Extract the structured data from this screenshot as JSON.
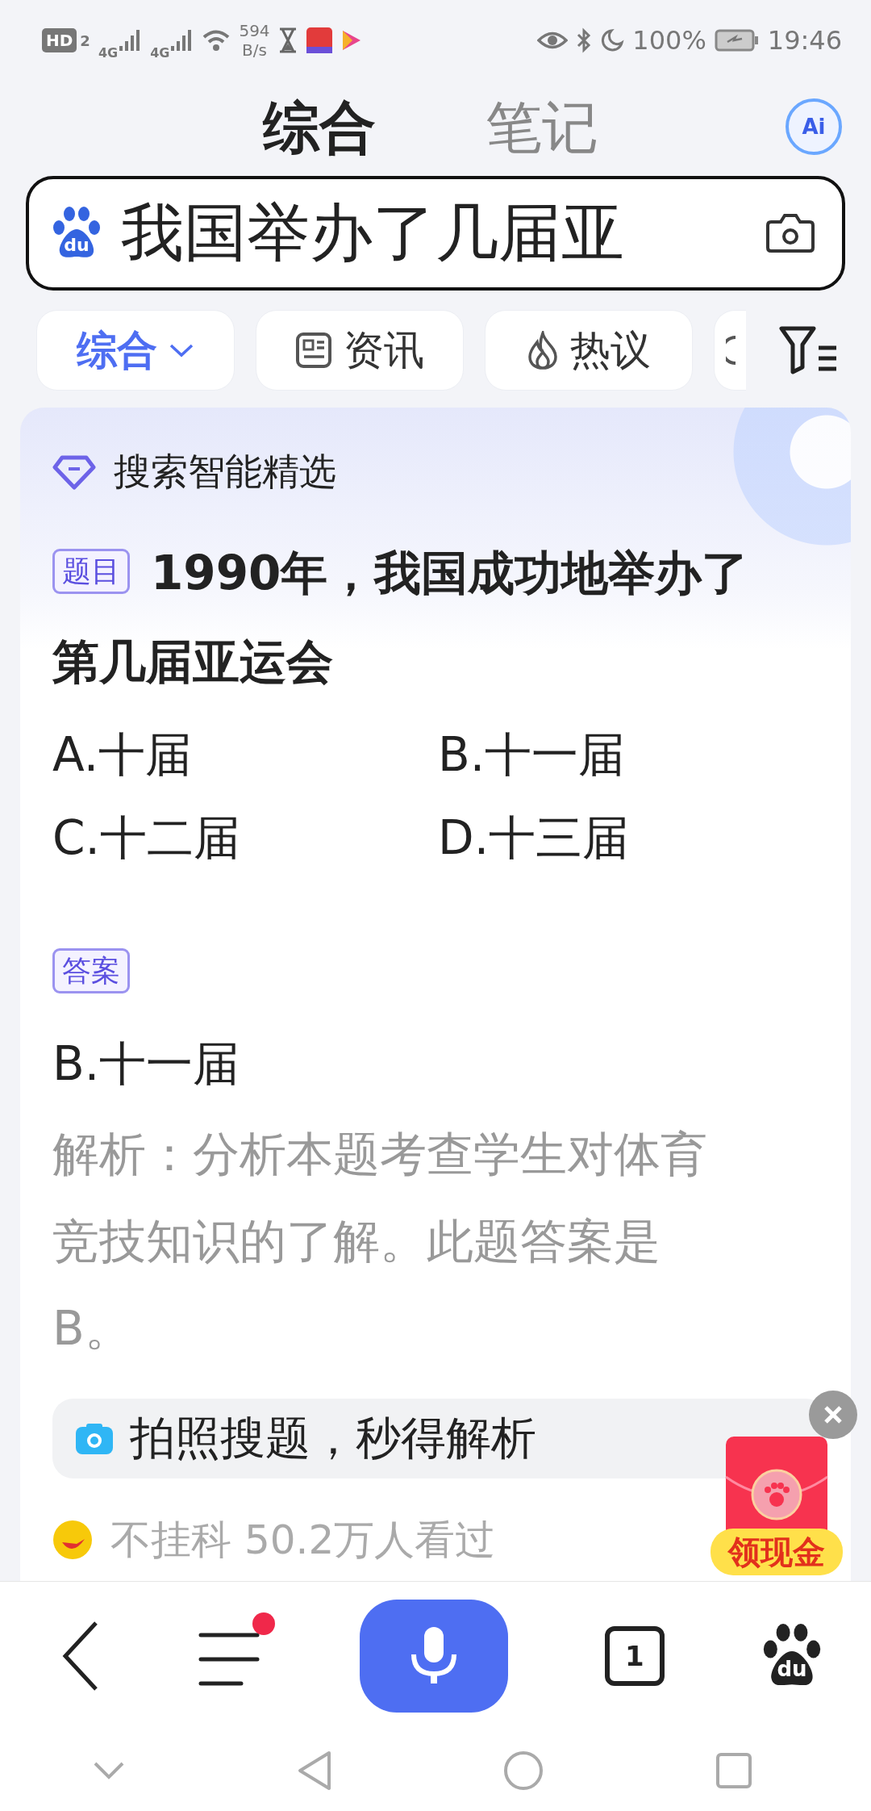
{
  "status_bar": {
    "hd_label": "HD",
    "sim_label": "2",
    "network_types": [
      "4G",
      "4G"
    ],
    "network_speed": "594",
    "speed_unit": "B/s",
    "battery": "100%",
    "time": "19:46"
  },
  "top_tabs": [
    {
      "label": "综合",
      "selected": true
    },
    {
      "label": "笔记",
      "selected": false
    }
  ],
  "ai_badge": "Ai",
  "search": {
    "logo_text": "du",
    "value": "我国举办了几届亚"
  },
  "chips": [
    {
      "kind": "dropdown",
      "label": "综合",
      "selected": true
    },
    {
      "kind": "news",
      "label": "资讯",
      "selected": false
    },
    {
      "kind": "hot",
      "label": "热议",
      "selected": false
    }
  ],
  "card": {
    "header": "搜索智能精选",
    "question_tag": "题目",
    "question_lines": [
      "1990年，我国成功地举办了",
      "第几届亚运会"
    ],
    "options": [
      "A.十届",
      "B.十一届",
      "C.十二届",
      "D.十三届"
    ],
    "answer_tag": "答案",
    "answer": "B.十一届",
    "explanation_lines": [
      "解析：分析本题考查学生对体育",
      "竞技知识的了解。此题答案是",
      "B。"
    ],
    "photo_search": "拍照搜题，秒得解析",
    "source": "不挂科 50.2万人看过"
  },
  "red_envelope": {
    "label": "领现金"
  },
  "bottom_nav": {
    "menu_notification": true,
    "tab_count": "1",
    "logo_text": "du"
  }
}
